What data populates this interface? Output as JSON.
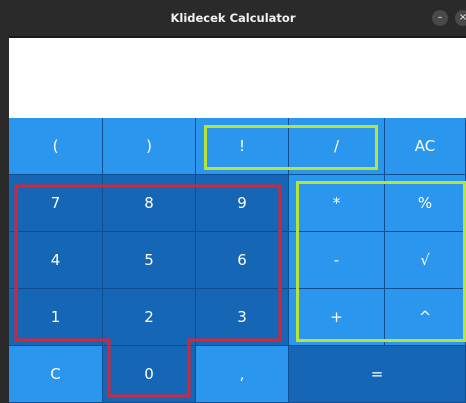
{
  "window": {
    "title": "Klidecek Calculator",
    "minimize_glyph": "–",
    "close_glyph": "×"
  },
  "display": {
    "value": ""
  },
  "keys": {
    "lparen": "(",
    "rparen": ")",
    "fact": "!",
    "divide": "/",
    "ac": "AC",
    "seven": "7",
    "eight": "8",
    "nine": "9",
    "multiply": "*",
    "percent": "%",
    "four": "4",
    "five": "5",
    "six": "6",
    "minus": "-",
    "sqrt": "√",
    "one": "1",
    "two": "2",
    "three": "3",
    "plus": "+",
    "power": "^",
    "clear": "C",
    "zero": "0",
    "dot": ",",
    "equals": "="
  },
  "colors": {
    "light_key": "#2b96ee",
    "dark_key": "#1566b5",
    "green_highlight": "#b7e33a",
    "red_highlight": "#d0273a"
  },
  "icons": {
    "minimize": "minimize-icon",
    "close": "close-icon"
  }
}
